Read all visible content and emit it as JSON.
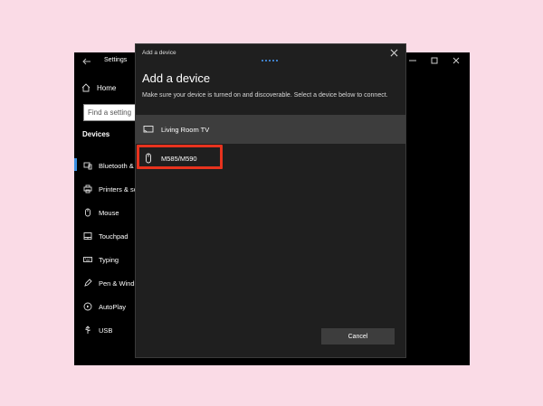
{
  "settings": {
    "title": "Settings",
    "home_label": "Home",
    "search_placeholder": "Find a setting",
    "section_heading": "Devices",
    "nav_items": [
      {
        "label": "Bluetooth & other devices",
        "icon": "bluetooth-devices-icon",
        "active": true
      },
      {
        "label": "Printers & scanners",
        "icon": "printer-icon",
        "active": false
      },
      {
        "label": "Mouse",
        "icon": "mouse-icon",
        "active": false
      },
      {
        "label": "Touchpad",
        "icon": "touchpad-icon",
        "active": false
      },
      {
        "label": "Typing",
        "icon": "keyboard-icon",
        "active": false
      },
      {
        "label": "Pen & Windows Ink",
        "icon": "pen-icon",
        "active": false
      },
      {
        "label": "AutoPlay",
        "icon": "autoplay-icon",
        "active": false
      },
      {
        "label": "USB",
        "icon": "usb-icon",
        "active": false
      }
    ]
  },
  "dialog": {
    "titlebar": "Add a device",
    "heading": "Add a device",
    "subtitle": "Make sure your device is turned on and discoverable. Select a device below to connect.",
    "devices": [
      {
        "name": "Living Room TV",
        "icon": "display-icon"
      },
      {
        "name": "M585/M590",
        "icon": "mouse-icon"
      }
    ],
    "cancel_label": "Cancel"
  },
  "colors": {
    "background": "#fadbe6",
    "highlight": "#e8331e",
    "accent": "#3b8ee0"
  }
}
